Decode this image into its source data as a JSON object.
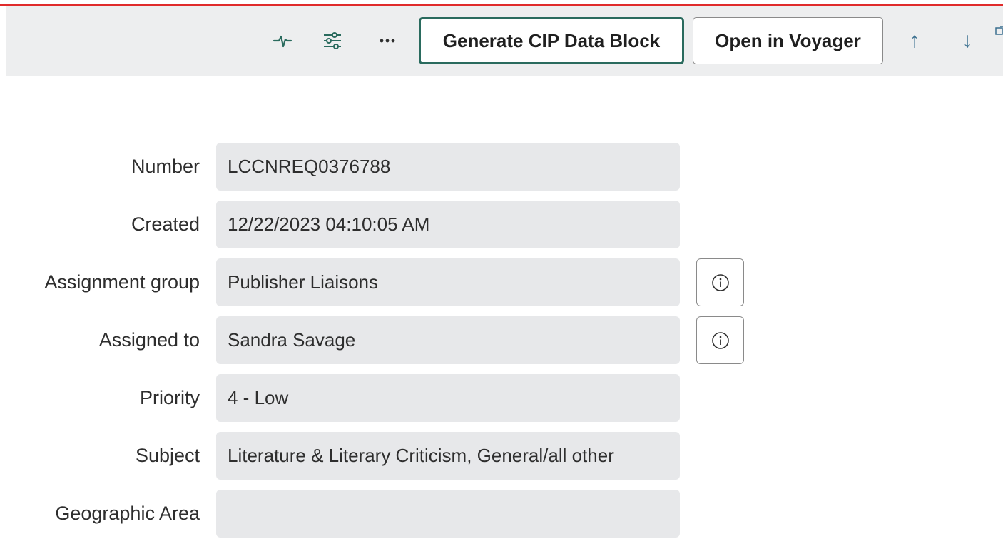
{
  "header": {
    "icons": [
      {
        "name": "activity-icon"
      },
      {
        "name": "settings-sliders-icon"
      },
      {
        "name": "more-options-icon"
      }
    ],
    "primary_button_label": "Generate CIP Data Block",
    "secondary_button_label": "Open in Voyager",
    "up_arrow_glyph": "↑",
    "down_arrow_glyph": "↓"
  },
  "form": {
    "rows": [
      {
        "label": "Number",
        "value": "LCCNREQ0376788"
      },
      {
        "label": "Created",
        "value": "12/22/2023 04:10:05 AM"
      },
      {
        "label": "Assignment group",
        "value": "Publisher Liaisons"
      },
      {
        "label": "Assigned to",
        "value": "Sandra Savage"
      },
      {
        "label": "Priority",
        "value": "4 - Low"
      },
      {
        "label": "Subject",
        "value": "Literature & Literary Criticism, General/all other"
      },
      {
        "label": "Geographic Area",
        "value": ""
      }
    ]
  },
  "colors": {
    "accent": "#2a6b5e",
    "header_bg": "#edeeef",
    "field_bg": "#e7e8ea",
    "top_line": "#e02b2b",
    "arrow": "#3a6f8f"
  }
}
